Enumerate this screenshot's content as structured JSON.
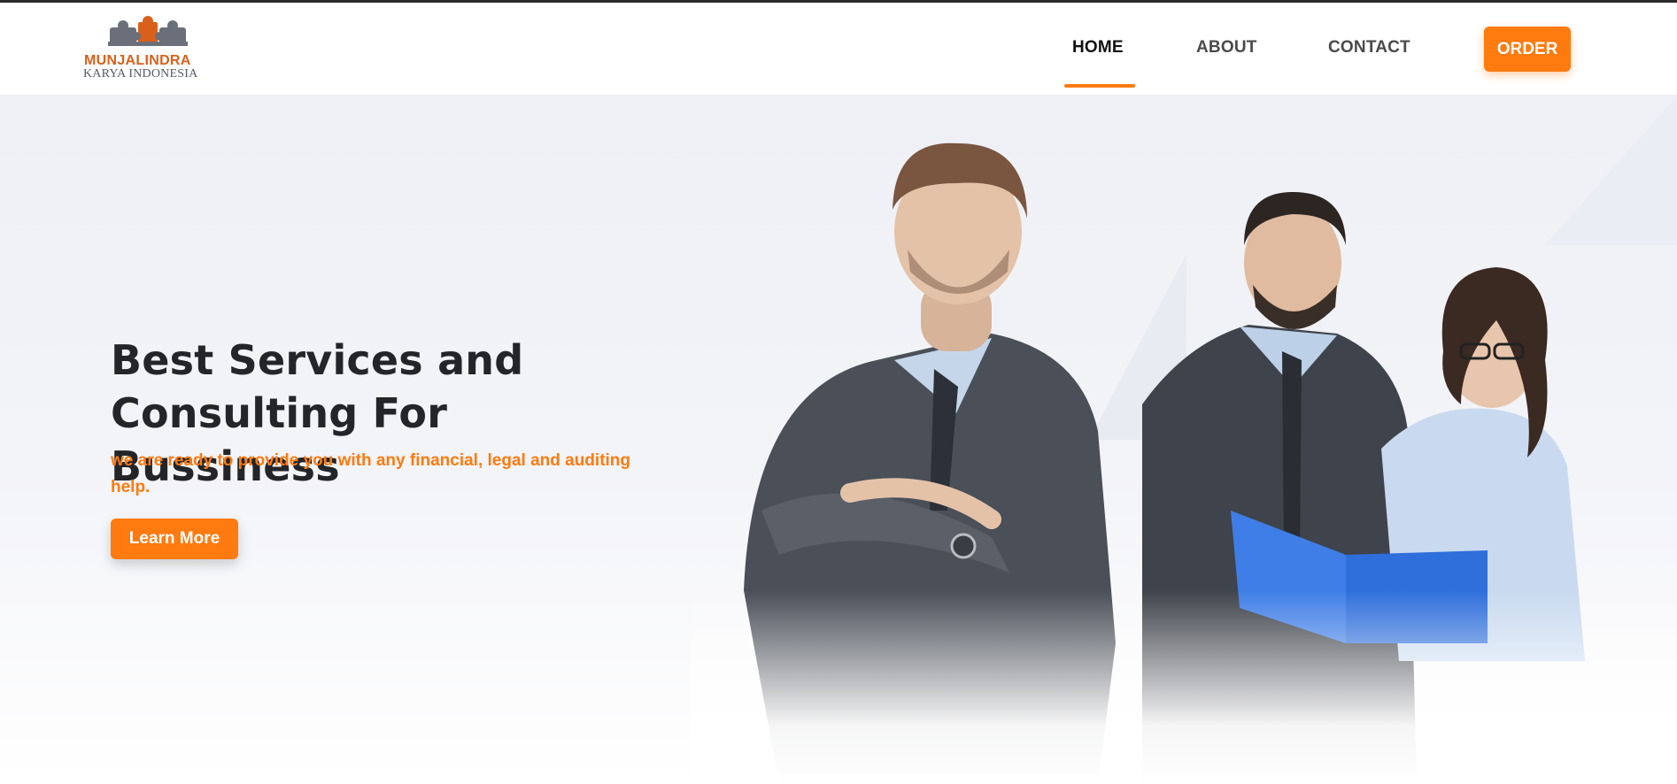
{
  "brand": {
    "name_line1": "MUNJALINDRA",
    "name_line2": "KARYA INDONESIA",
    "colors": {
      "accent": "#ff7a0f",
      "logo_orange": "#d9601a",
      "logo_gray": "#6b6f7a"
    }
  },
  "nav": {
    "items": [
      {
        "label": "HOME",
        "active": true
      },
      {
        "label": "ABOUT",
        "active": false
      },
      {
        "label": "CONTACT",
        "active": false
      }
    ],
    "order_label": "ORDER"
  },
  "hero": {
    "title_line1": "Best Services and",
    "title_line2": "Consulting For Bussiness",
    "subtitle": "we are ready to provide you with any financial, legal and auditing help.",
    "cta_label": "Learn More",
    "image": "business-team-photo"
  }
}
